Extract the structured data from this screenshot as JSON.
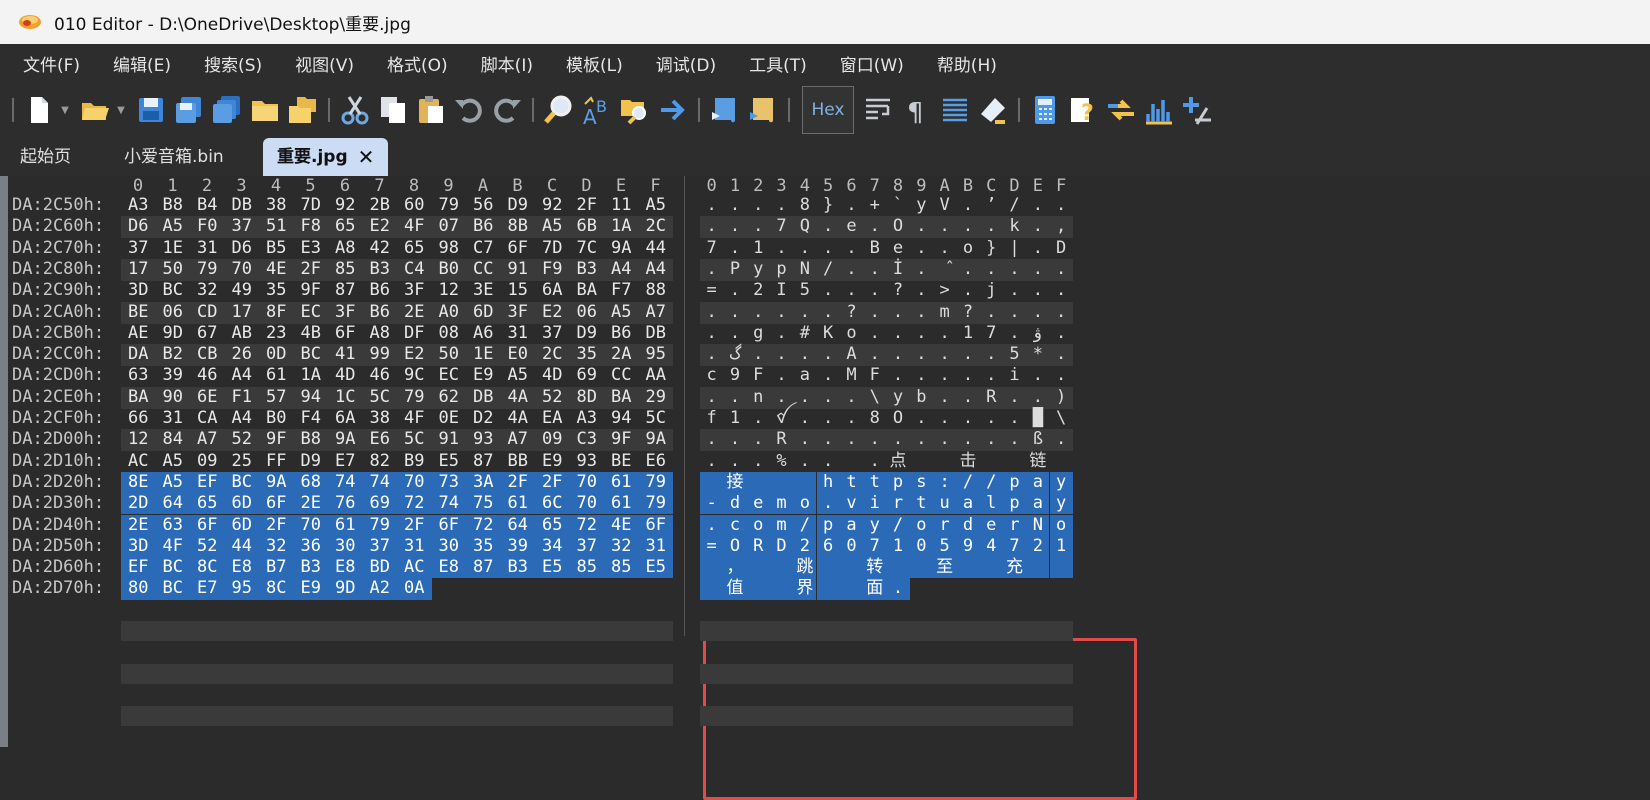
{
  "window": {
    "title": "010 Editor - D:\\OneDrive\\Desktop\\重要.jpg"
  },
  "menu": [
    "文件(F)",
    "编辑(E)",
    "搜索(S)",
    "视图(V)",
    "格式(O)",
    "脚本(I)",
    "模板(L)",
    "调试(D)",
    "工具(T)",
    "窗口(W)",
    "帮助(H)"
  ],
  "toolbar": {
    "hex_label": "Hex"
  },
  "tabs": [
    {
      "label": "起始页",
      "active": false
    },
    {
      "label": "小爱音箱.bin",
      "active": false
    },
    {
      "label": "重要.jpg",
      "active": true
    }
  ],
  "hex_view": {
    "hex_columns": [
      "0",
      "1",
      "2",
      "3",
      "4",
      "5",
      "6",
      "7",
      "8",
      "9",
      "A",
      "B",
      "C",
      "D",
      "E",
      "F"
    ],
    "rows": [
      {
        "addr": "DA:2C50h:",
        "bytes": [
          "A3",
          "B8",
          "B4",
          "DB",
          "38",
          "7D",
          "92",
          "2B",
          "60",
          "79",
          "56",
          "D9",
          "92",
          "2F",
          "11",
          "A5"
        ],
        "text": [
          ".",
          ".",
          ".",
          ".",
          "8",
          "}",
          ".",
          "+",
          "`",
          "y",
          "V",
          ".",
          "’",
          "/",
          ".",
          "."
        ]
      },
      {
        "addr": "DA:2C60h:",
        "bytes": [
          "D6",
          "A5",
          "F0",
          "37",
          "51",
          "F8",
          "65",
          "E2",
          "4F",
          "07",
          "B6",
          "8B",
          "A5",
          "6B",
          "1A",
          "2C"
        ],
        "text": [
          ".",
          ".",
          ".",
          "7",
          "Q",
          ".",
          "e",
          ".",
          "O",
          ".",
          ".",
          ".",
          ".",
          "k",
          ".",
          ","
        ]
      },
      {
        "addr": "DA:2C70h:",
        "bytes": [
          "37",
          "1E",
          "31",
          "D6",
          "B5",
          "E3",
          "A8",
          "42",
          "65",
          "98",
          "C7",
          "6F",
          "7D",
          "7C",
          "9A",
          "44"
        ],
        "text": [
          "7",
          ".",
          "1",
          ".",
          ".",
          ".",
          ".",
          "B",
          "e",
          ".",
          ".",
          "o",
          "}",
          "|",
          ".",
          "D"
        ]
      },
      {
        "addr": "DA:2C80h:",
        "bytes": [
          "17",
          "50",
          "79",
          "70",
          "4E",
          "2F",
          "85",
          "B3",
          "C4",
          "B0",
          "CC",
          "91",
          "F9",
          "B3",
          "A4",
          "A4"
        ],
        "text": [
          ".",
          "P",
          "y",
          "p",
          "N",
          "/",
          ".",
          ".",
          "İ",
          ".",
          "̂",
          ".",
          ".",
          ".",
          ".",
          "."
        ]
      },
      {
        "addr": "DA:2C90h:",
        "bytes": [
          "3D",
          "BC",
          "32",
          "49",
          "35",
          "9F",
          "87",
          "B6",
          "3F",
          "12",
          "3E",
          "15",
          "6A",
          "BA",
          "F7",
          "88"
        ],
        "text": [
          "=",
          ".",
          "2",
          "I",
          "5",
          ".",
          ".",
          ".",
          "?",
          ".",
          ">",
          ".",
          "j",
          ".",
          ".",
          "."
        ]
      },
      {
        "addr": "DA:2CA0h:",
        "bytes": [
          "BE",
          "06",
          "CD",
          "17",
          "8F",
          "EC",
          "3F",
          "B6",
          "2E",
          "A0",
          "6D",
          "3F",
          "E2",
          "06",
          "A5",
          "A7"
        ],
        "text": [
          ".",
          ".",
          ".",
          ".",
          ".",
          ".",
          "?",
          ".",
          ".",
          ".",
          "m",
          "?",
          ".",
          ".",
          ".",
          "."
        ]
      },
      {
        "addr": "DA:2CB0h:",
        "bytes": [
          "AE",
          "9D",
          "67",
          "AB",
          "23",
          "4B",
          "6F",
          "A8",
          "DF",
          "08",
          "A6",
          "31",
          "37",
          "D9",
          "B6",
          "DB"
        ],
        "text": [
          ".",
          ".",
          "g",
          ".",
          "#",
          "K",
          "o",
          ".",
          ".",
          ".",
          ".",
          "1",
          "7",
          ".",
          "ۋ",
          "."
        ]
      },
      {
        "addr": "DA:2CC0h:",
        "bytes": [
          "DA",
          "B2",
          "CB",
          "26",
          "0D",
          "BC",
          "41",
          "99",
          "E2",
          "50",
          "1E",
          "E0",
          "2C",
          "35",
          "2A",
          "95"
        ],
        "text": [
          ".",
          "گ",
          ".",
          ".",
          ".",
          ".",
          "A",
          ".",
          ".",
          ".",
          ".",
          ".",
          ".",
          "5",
          "*",
          "."
        ]
      },
      {
        "addr": "DA:2CD0h:",
        "bytes": [
          "63",
          "39",
          "46",
          "A4",
          "61",
          "1A",
          "4D",
          "46",
          "9C",
          "EC",
          "E9",
          "A5",
          "4D",
          "69",
          "CC",
          "AA"
        ],
        "text": [
          "c",
          "9",
          "F",
          ".",
          "a",
          ".",
          "M",
          "F",
          ".",
          ".",
          ".",
          ".",
          ".",
          "i",
          ".",
          "."
        ]
      },
      {
        "addr": "DA:2CE0h:",
        "bytes": [
          "BA",
          "90",
          "6E",
          "F1",
          "57",
          "94",
          "1C",
          "5C",
          "79",
          "62",
          "DB",
          "4A",
          "52",
          "8D",
          "BA",
          "29"
        ],
        "text": [
          ".",
          ".",
          "n",
          ".",
          ".",
          ".",
          ".",
          "\\",
          "y",
          "b",
          ".",
          ".",
          "R",
          ".",
          ".",
          ")"
        ]
      },
      {
        "addr": "DA:2CF0h:",
        "bytes": [
          "66",
          "31",
          "CA",
          "A4",
          "B0",
          "F4",
          "6A",
          "38",
          "4F",
          "0E",
          "D2",
          "4A",
          "EA",
          "A3",
          "94",
          "5C"
        ],
        "text": [
          "f",
          "1",
          ".",
          "ꪤ",
          ".",
          ".",
          ".",
          "8",
          "O",
          ".",
          ".",
          ".",
          ".",
          ".",
          "█",
          "\\"
        ]
      },
      {
        "addr": "DA:2D00h:",
        "bytes": [
          "12",
          "84",
          "A7",
          "52",
          "9F",
          "B8",
          "9A",
          "E6",
          "5C",
          "91",
          "93",
          "A7",
          "09",
          "C3",
          "9F",
          "9A"
        ],
        "text": [
          ".",
          ".",
          ".",
          "R",
          ".",
          ".",
          ".",
          ".",
          ".",
          ".",
          ".",
          ".",
          ".",
          ".",
          "ß",
          "."
        ]
      },
      {
        "addr": "DA:2D10h:",
        "bytes": [
          "AC",
          "A5",
          "09",
          "25",
          "FF",
          "D9",
          "E7",
          "82",
          "B9",
          "E5",
          "87",
          "BB",
          "E9",
          "93",
          "BE",
          "E6"
        ],
        "text": [
          ".",
          ".",
          ".",
          "%",
          ".",
          ".",
          "",
          ".",
          "点",
          "",
          "",
          "击",
          "",
          "",
          "链",
          ""
        ]
      },
      {
        "addr": "DA:2D20h:",
        "bytes": [
          "8E",
          "A5",
          "EF",
          "BC",
          "9A",
          "68",
          "74",
          "74",
          "70",
          "73",
          "3A",
          "2F",
          "2F",
          "70",
          "61",
          "79"
        ],
        "text": [
          "",
          "接",
          "",
          "",
          "",
          "h",
          "t",
          "t",
          "p",
          "s",
          ":",
          "/",
          "/",
          "p",
          "a",
          "y"
        ]
      },
      {
        "addr": "DA:2D30h:",
        "bytes": [
          "2D",
          "64",
          "65",
          "6D",
          "6F",
          "2E",
          "76",
          "69",
          "72",
          "74",
          "75",
          "61",
          "6C",
          "70",
          "61",
          "79"
        ],
        "text": [
          "-",
          "d",
          "e",
          "m",
          "o",
          ".",
          "v",
          "i",
          "r",
          "t",
          "u",
          "a",
          "l",
          "p",
          "a",
          "y"
        ]
      },
      {
        "addr": "DA:2D40h:",
        "bytes": [
          "2E",
          "63",
          "6F",
          "6D",
          "2F",
          "70",
          "61",
          "79",
          "2F",
          "6F",
          "72",
          "64",
          "65",
          "72",
          "4E",
          "6F"
        ],
        "text": [
          ".",
          "c",
          "o",
          "m",
          "/",
          "p",
          "a",
          "y",
          "/",
          "o",
          "r",
          "d",
          "e",
          "r",
          "N",
          "o"
        ]
      },
      {
        "addr": "DA:2D50h:",
        "bytes": [
          "3D",
          "4F",
          "52",
          "44",
          "32",
          "36",
          "30",
          "37",
          "31",
          "30",
          "35",
          "39",
          "34",
          "37",
          "32",
          "31"
        ],
        "text": [
          "=",
          "O",
          "R",
          "D",
          "2",
          "6",
          "0",
          "7",
          "1",
          "0",
          "5",
          "9",
          "4",
          "7",
          "2",
          "1"
        ]
      },
      {
        "addr": "DA:2D60h:",
        "bytes": [
          "EF",
          "BC",
          "8C",
          "E8",
          "B7",
          "B3",
          "E8",
          "BD",
          "AC",
          "E8",
          "87",
          "B3",
          "E5",
          "85",
          "85",
          "E5"
        ],
        "text": [
          "",
          "，",
          "",
          "",
          "跳",
          "",
          "",
          "转",
          "",
          "",
          "至",
          "",
          "",
          "充",
          "",
          ""
        ]
      },
      {
        "addr": "DA:2D70h:",
        "bytes": [
          "80",
          "BC",
          "E7",
          "95",
          "8C",
          "E9",
          "9D",
          "A2",
          "0A"
        ],
        "text": [
          "",
          "值",
          "",
          "",
          "界",
          "",
          "",
          "面",
          "."
        ]
      }
    ]
  }
}
